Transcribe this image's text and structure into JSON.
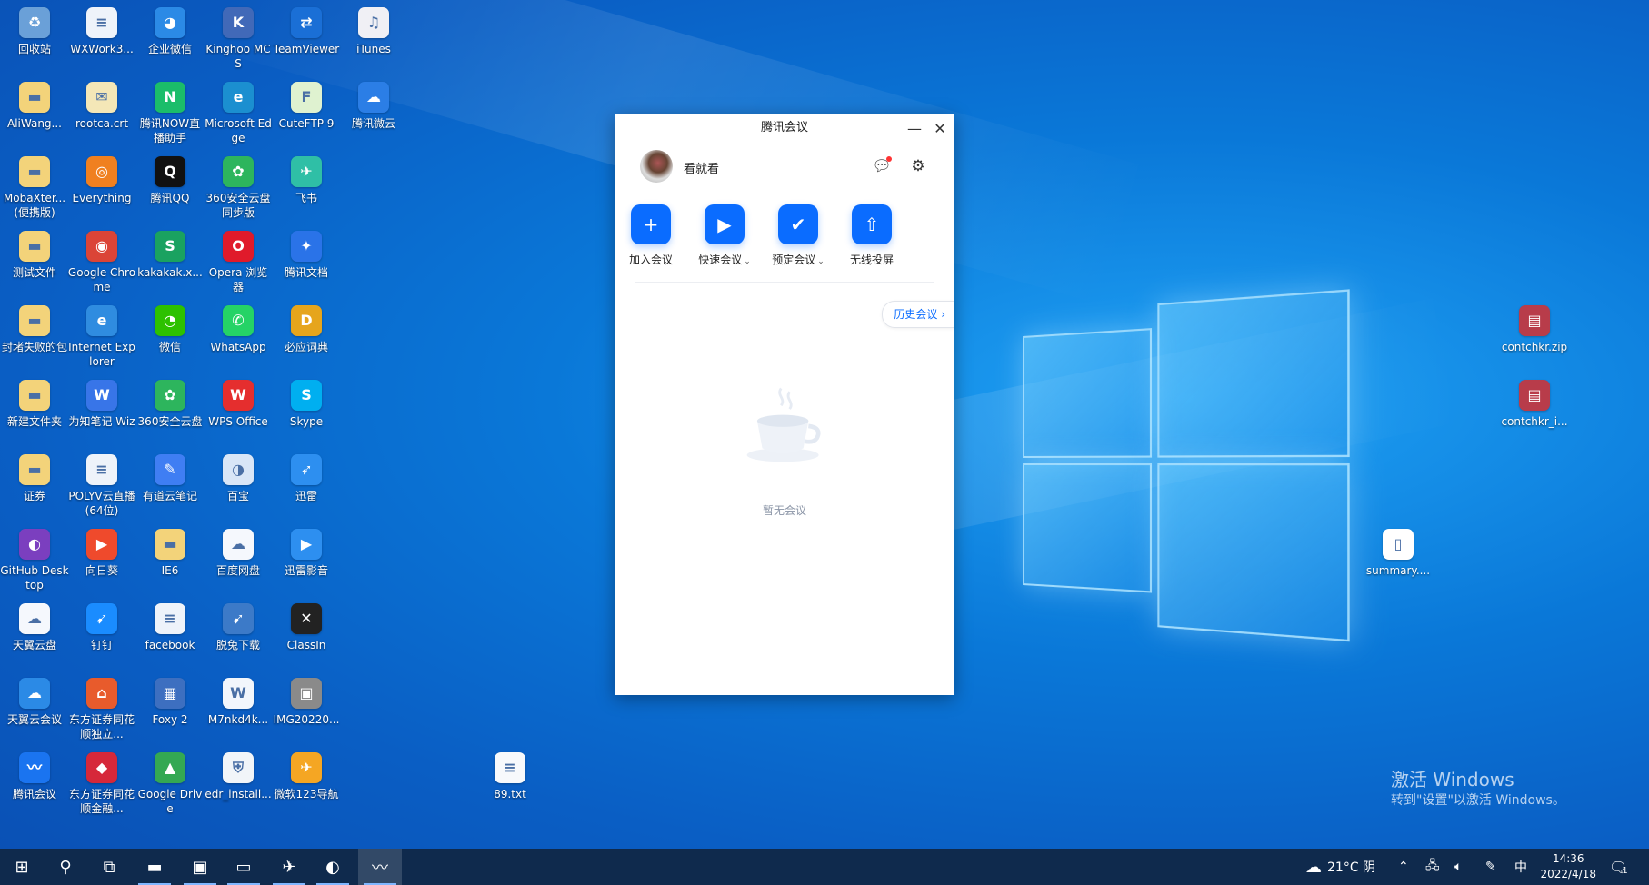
{
  "desktop": {
    "icons": [
      {
        "label": "回收站",
        "icon": "recycle-bin-icon",
        "glyph": "♻",
        "color": "#6aa0d8"
      },
      {
        "label": "WXWork3...",
        "icon": "file-icon",
        "glyph": "≡",
        "color": "#eef3fa"
      },
      {
        "label": "企业微信",
        "icon": "wecom-icon",
        "glyph": "◕",
        "color": "#2b8ae6"
      },
      {
        "label": "Kinghoo MCS",
        "icon": "kinghoo-icon",
        "glyph": "K",
        "color": "#4169b8"
      },
      {
        "label": "TeamViewer",
        "icon": "teamviewer-icon",
        "glyph": "⇄",
        "color": "#1a6fd6"
      },
      {
        "label": "iTunes",
        "icon": "itunes-icon",
        "glyph": "♫",
        "color": "#f0f0f5"
      },
      {
        "label": "AliWang...",
        "icon": "folder-icon",
        "glyph": "▬",
        "color": "#f3d37a"
      },
      {
        "label": "rootca.crt",
        "icon": "certificate-icon",
        "glyph": "✉",
        "color": "#f4e7b7"
      },
      {
        "label": "腾讯NOW直播助手",
        "icon": "tencent-now-icon",
        "glyph": "N",
        "color": "#1bbd6a"
      },
      {
        "label": "Microsoft Edge",
        "icon": "edge-icon",
        "glyph": "e",
        "color": "#1b8fd0"
      },
      {
        "label": "CuteFTP 9",
        "icon": "cuteftp-icon",
        "glyph": "F",
        "color": "#dff2d0"
      },
      {
        "label": "腾讯微云",
        "icon": "weiyun-icon",
        "glyph": "☁",
        "color": "#2b7ee6"
      },
      {
        "label": "MobaXter...(便携版)",
        "icon": "folder-icon",
        "glyph": "▬",
        "color": "#f3d37a"
      },
      {
        "label": "Everything",
        "icon": "everything-icon",
        "glyph": "◎",
        "color": "#f08020"
      },
      {
        "label": "腾讯QQ",
        "icon": "qq-icon",
        "glyph": "Q",
        "color": "#111111"
      },
      {
        "label": "360安全云盘同步版",
        "icon": "360-sync-icon",
        "glyph": "✿",
        "color": "#2db55d"
      },
      {
        "label": "飞书",
        "icon": "feishu-icon",
        "glyph": "✈",
        "color": "#2fbfa6"
      },
      {
        "label": "测试文件",
        "icon": "folder-icon",
        "glyph": "▬",
        "color": "#f3d37a"
      },
      {
        "label": "Google Chrome",
        "icon": "chrome-icon",
        "glyph": "◉",
        "color": "#db4437"
      },
      {
        "label": "kakakak.x...",
        "icon": "spreadsheet-icon",
        "glyph": "S",
        "color": "#1aa260"
      },
      {
        "label": "Opera 浏览器",
        "icon": "opera-icon",
        "glyph": "O",
        "color": "#e01a2b"
      },
      {
        "label": "腾讯文档",
        "icon": "tencent-docs-icon",
        "glyph": "✦",
        "color": "#2a73e8"
      },
      {
        "label": "封堵失败的包",
        "icon": "folder-icon",
        "glyph": "▬",
        "color": "#f3d37a"
      },
      {
        "label": "Internet Explorer",
        "icon": "ie-icon",
        "glyph": "e",
        "color": "#2f8ce0"
      },
      {
        "label": "微信",
        "icon": "wechat-icon",
        "glyph": "◔",
        "color": "#2dc100"
      },
      {
        "label": "WhatsApp",
        "icon": "whatsapp-icon",
        "glyph": "✆",
        "color": "#25d366"
      },
      {
        "label": "必应词典",
        "icon": "bing-dict-icon",
        "glyph": "D",
        "color": "#e6a51c"
      },
      {
        "label": "新建文件夹",
        "icon": "folder-icon",
        "glyph": "▬",
        "color": "#f3d37a"
      },
      {
        "label": "为知笔记 Wiz",
        "icon": "wiz-icon",
        "glyph": "W",
        "color": "#3875e8"
      },
      {
        "label": "360安全云盘",
        "icon": "360-cloud-icon",
        "glyph": "✿",
        "color": "#2db55d"
      },
      {
        "label": "WPS Office",
        "icon": "wps-icon",
        "glyph": "W",
        "color": "#e52e2e"
      },
      {
        "label": "Skype",
        "icon": "skype-icon",
        "glyph": "S",
        "color": "#00aff0"
      },
      {
        "label": "证券",
        "icon": "folder-icon",
        "glyph": "▬",
        "color": "#f3d37a"
      },
      {
        "label": "POLYV云直播(64位)",
        "icon": "file-icon",
        "glyph": "≡",
        "color": "#eef3fa"
      },
      {
        "label": "有道云笔记",
        "icon": "youdao-note-icon",
        "glyph": "✎",
        "color": "#3f7ef3"
      },
      {
        "label": "百宝",
        "icon": "baibao-icon",
        "glyph": "◑",
        "color": "#d9e6f7"
      },
      {
        "label": "迅雷",
        "icon": "xunlei-icon",
        "glyph": "➶",
        "color": "#2d8ff0"
      },
      {
        "label": "GitHub Desktop",
        "icon": "github-icon",
        "glyph": "◐",
        "color": "#7b3fbf"
      },
      {
        "label": "向日葵",
        "icon": "sunflower-icon",
        "glyph": "▶",
        "color": "#ef4a2c"
      },
      {
        "label": "IE6",
        "icon": "folder-icon",
        "glyph": "▬",
        "color": "#f3d37a"
      },
      {
        "label": "百度网盘",
        "icon": "baidu-netdisk-icon",
        "glyph": "☁",
        "color": "#f5f8fd"
      },
      {
        "label": "迅雷影音",
        "icon": "xunlei-player-icon",
        "glyph": "▶",
        "color": "#2d8ff0"
      },
      {
        "label": "天翼云盘",
        "icon": "tianyi-cloud-icon",
        "glyph": "☁",
        "color": "#f5f8fd"
      },
      {
        "label": "钉钉",
        "icon": "dingtalk-icon",
        "glyph": "➹",
        "color": "#1a8cff"
      },
      {
        "label": "facebook",
        "icon": "file-icon",
        "glyph": "≡",
        "color": "#eef3fa"
      },
      {
        "label": "脱兔下载",
        "icon": "tuotu-icon",
        "glyph": "➹",
        "color": "#3c7ac8"
      },
      {
        "label": "ClassIn",
        "icon": "classin-icon",
        "glyph": "✕",
        "color": "#222222"
      },
      {
        "label": "天翼云会议",
        "icon": "tianyi-meeting-icon",
        "glyph": "☁",
        "color": "#2b8ae6"
      },
      {
        "label": "东方证券同花顺独立...",
        "icon": "tonghuashun-icon",
        "glyph": "⌂",
        "color": "#e85b2c"
      },
      {
        "label": "Foxy 2",
        "icon": "foxy-icon",
        "glyph": "▦",
        "color": "#3d6fc0"
      },
      {
        "label": "M7nkd4k...",
        "icon": "word-file-icon",
        "glyph": "W",
        "color": "#f2f6fc"
      },
      {
        "label": "IMG20220...",
        "icon": "image-file-icon",
        "glyph": "▣",
        "color": "#8a8a8a"
      },
      {
        "label": "腾讯会议",
        "icon": "tencent-meeting-icon",
        "glyph": "〰",
        "color": "#1a74f0"
      },
      {
        "label": "东方证券同花顺金融...",
        "icon": "tonghuashun-finance-icon",
        "glyph": "◆",
        "color": "#d6283a"
      },
      {
        "label": "Google Drive",
        "icon": "google-drive-icon",
        "glyph": "▲",
        "color": "#34a853"
      },
      {
        "label": "edr_install...",
        "icon": "edr-install-icon",
        "glyph": "⛨",
        "color": "#f1f5f9"
      },
      {
        "label": "微软123导航",
        "icon": "nav123-icon",
        "glyph": "✈",
        "color": "#f5a623"
      },
      {
        "label": "89.txt",
        "icon": "text-file-icon",
        "glyph": "≡",
        "color": "#f7f9fc"
      },
      {
        "label": "contchkr.zip",
        "icon": "winrar-icon",
        "glyph": "▤",
        "color": "#b83c4a"
      },
      {
        "label": "contchkr_i...",
        "icon": "winrar-icon",
        "glyph": "▤",
        "color": "#b83c4a"
      },
      {
        "label": "summary....",
        "icon": "file-icon",
        "glyph": "▯",
        "color": "#ffffff"
      }
    ]
  },
  "meeting_window": {
    "title": "腾讯会议",
    "minimize_glyph": "—",
    "close_glyph": "✕",
    "user_name": "看就看",
    "actions": [
      {
        "label": "加入会议",
        "icon": "join-meeting-icon",
        "glyph": "+",
        "dropdown": ""
      },
      {
        "label": "快速会议",
        "icon": "quick-meeting-icon",
        "glyph": "▶",
        "dropdown": "⌄"
      },
      {
        "label": "预定会议",
        "icon": "schedule-meeting-icon",
        "glyph": "✔",
        "dropdown": "⌄"
      },
      {
        "label": "无线投屏",
        "icon": "wireless-cast-icon",
        "glyph": "⇧",
        "dropdown": ""
      }
    ],
    "history_label": "历史会议",
    "history_chevron": "›",
    "empty_text": "暂无会议",
    "accent": "#0a6cff"
  },
  "watermark": {
    "line1": "激活 Windows",
    "line2": "转到\"设置\"以激活 Windows。"
  },
  "taskbar": {
    "weather": "21°C 阴",
    "ime": "中",
    "time": "14:36",
    "date": "2022/4/18",
    "notification_count": "1",
    "pinned": [
      {
        "icon": "start-icon",
        "glyph": "⊞"
      },
      {
        "icon": "search-icon",
        "glyph": "⚲"
      },
      {
        "icon": "task-view-icon",
        "glyph": "⧉"
      },
      {
        "icon": "file-explorer-icon",
        "glyph": "▬"
      },
      {
        "icon": "store-icon",
        "glyph": "▣"
      },
      {
        "icon": "terminal-icon",
        "glyph": "▭"
      },
      {
        "icon": "feishu-taskbar-icon",
        "glyph": "✈"
      },
      {
        "icon": "browser-taskbar-icon",
        "glyph": "◐"
      },
      {
        "icon": "tencent-meeting-taskbar-icon",
        "glyph": "〰"
      }
    ]
  }
}
